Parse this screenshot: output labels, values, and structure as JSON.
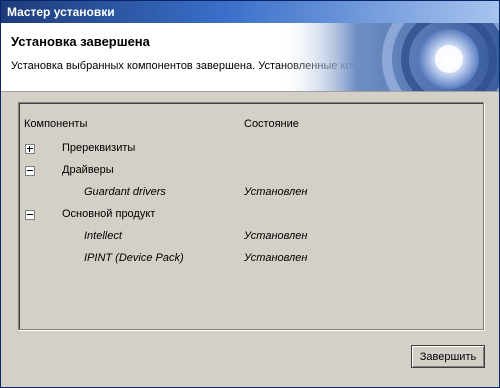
{
  "window": {
    "title": "Мастер установки"
  },
  "header": {
    "title": "Установка завершена",
    "subtitle": "Установка выбранных компонентов завершена. Установленные компоненты:"
  },
  "table": {
    "columns": [
      "Компоненты",
      "Состояние"
    ],
    "rows": [
      {
        "label": "Пререквизиты",
        "status": "",
        "expander": "plus",
        "level": 0
      },
      {
        "label": "Драйверы",
        "status": "",
        "expander": "minus",
        "level": 0
      },
      {
        "label": "Guardant drivers",
        "status": "Установлен",
        "expander": "",
        "level": 1
      },
      {
        "label": "Основной продукт",
        "status": "",
        "expander": "minus",
        "level": 0
      },
      {
        "label": "Intellect",
        "status": "Установлен",
        "expander": "",
        "level": 1
      },
      {
        "label": "IPINT (Device Pack)",
        "status": "Установлен",
        "expander": "",
        "level": 1
      }
    ]
  },
  "buttons": {
    "finish": "Завершить"
  }
}
